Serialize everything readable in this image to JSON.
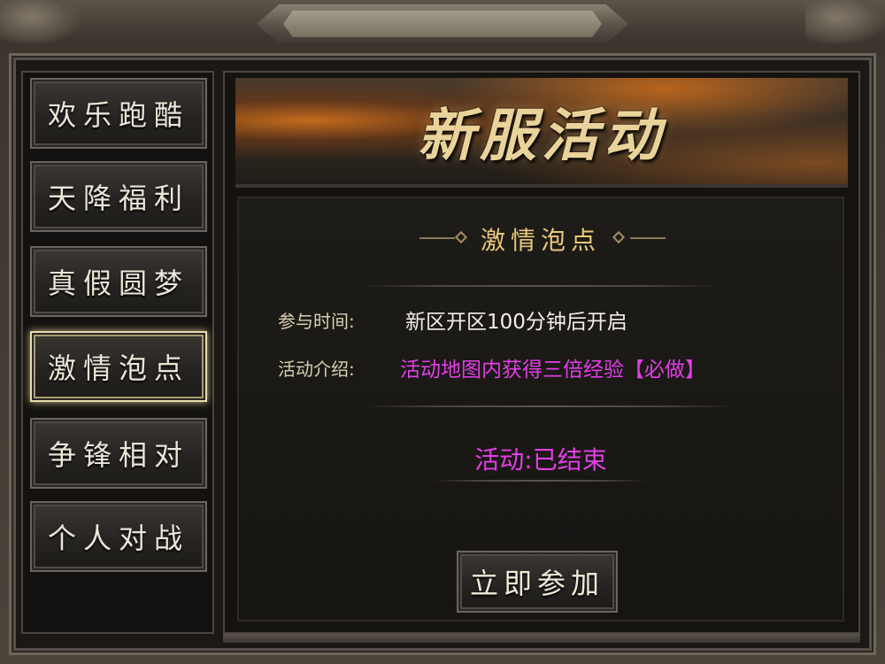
{
  "sidebar": {
    "items": [
      {
        "label": "欢乐跑酷",
        "active": false
      },
      {
        "label": "天降福利",
        "active": false
      },
      {
        "label": "真假圆梦",
        "active": false
      },
      {
        "label": "激情泡点",
        "active": true
      },
      {
        "label": "争锋相对",
        "active": false
      },
      {
        "label": "个人对战",
        "active": false
      }
    ]
  },
  "banner": {
    "title": "新服活动"
  },
  "event": {
    "title": "激情泡点",
    "time_label": "参与时间:",
    "time_value": "新区开区100分钟后开启",
    "intro_label": "活动介绍:",
    "intro_value": "活动地图内获得三倍经验【必做】",
    "status": "活动:已结束",
    "join_label": "立即参加"
  },
  "colors": {
    "accent_gold": "#e8c87a",
    "highlight_magenta": "#e23ee6",
    "active_border": "#e6dcae"
  }
}
